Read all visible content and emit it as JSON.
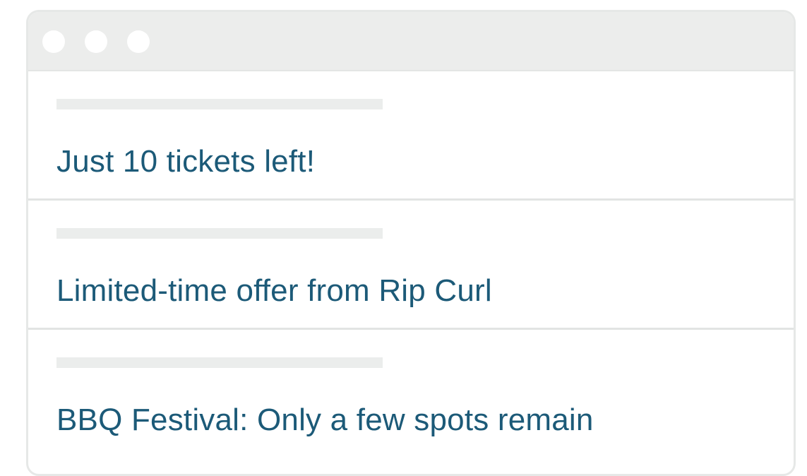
{
  "window": {
    "controls": [
      "window-dot",
      "window-dot",
      "window-dot"
    ]
  },
  "notifications": [
    {
      "text": "Just 10 tickets left!"
    },
    {
      "text": "Limited-time offer from Rip Curl"
    },
    {
      "text": "BBQ Festival: Only a few spots remain"
    }
  ],
  "colors": {
    "text": "#1c5a78",
    "titlebar": "#ecedec",
    "placeholder": "#ebedec",
    "divider": "#e2e4e3"
  }
}
